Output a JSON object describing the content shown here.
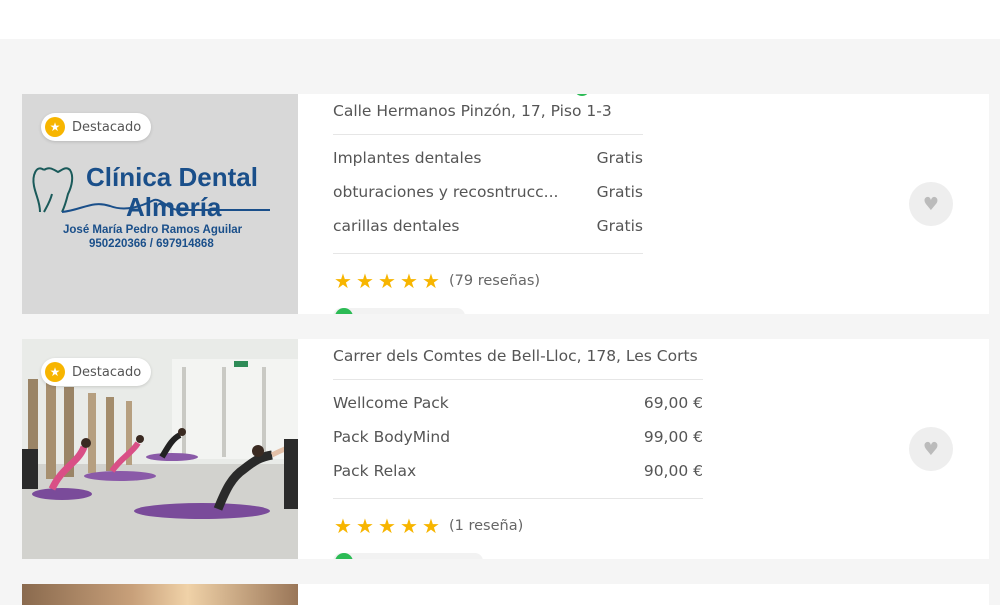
{
  "listings": [
    {
      "badge": "Destacado",
      "address": "Calle Hermanos Pinzón, 17, Piso 1-3",
      "services": [
        {
          "name": "Implantes dentales",
          "price": "Gratis"
        },
        {
          "name": "obturaciones y recosntrucc...",
          "price": "Gratis"
        },
        {
          "name": "carillas dentales",
          "price": "Gratis"
        }
      ],
      "rating": 5,
      "reviews": "(79 reseñas)",
      "image": {
        "title_line1": "Clínica Dental",
        "title_line2": "Almería",
        "doctor": "José María Pedro Ramos Aguilar",
        "phones": "950220366 / 697914868"
      }
    },
    {
      "badge": "Destacado",
      "address": "Carrer dels Comtes de Bell-Lloc, 178, Les Corts",
      "services": [
        {
          "name": "Wellcome Pack",
          "price": "69,00 €"
        },
        {
          "name": "Pack BodyMind",
          "price": "99,00 €"
        },
        {
          "name": "Pack Relax",
          "price": "90,00 €"
        }
      ],
      "rating": 5,
      "reviews": "(1 reseña)"
    }
  ],
  "icons": {
    "badge": "star-icon",
    "favorite": "heart-icon",
    "rating": "star-icon"
  },
  "colors": {
    "accent_star": "#f7b500",
    "logo_blue": "#1a4f8a",
    "status_green": "#2cbb55"
  }
}
